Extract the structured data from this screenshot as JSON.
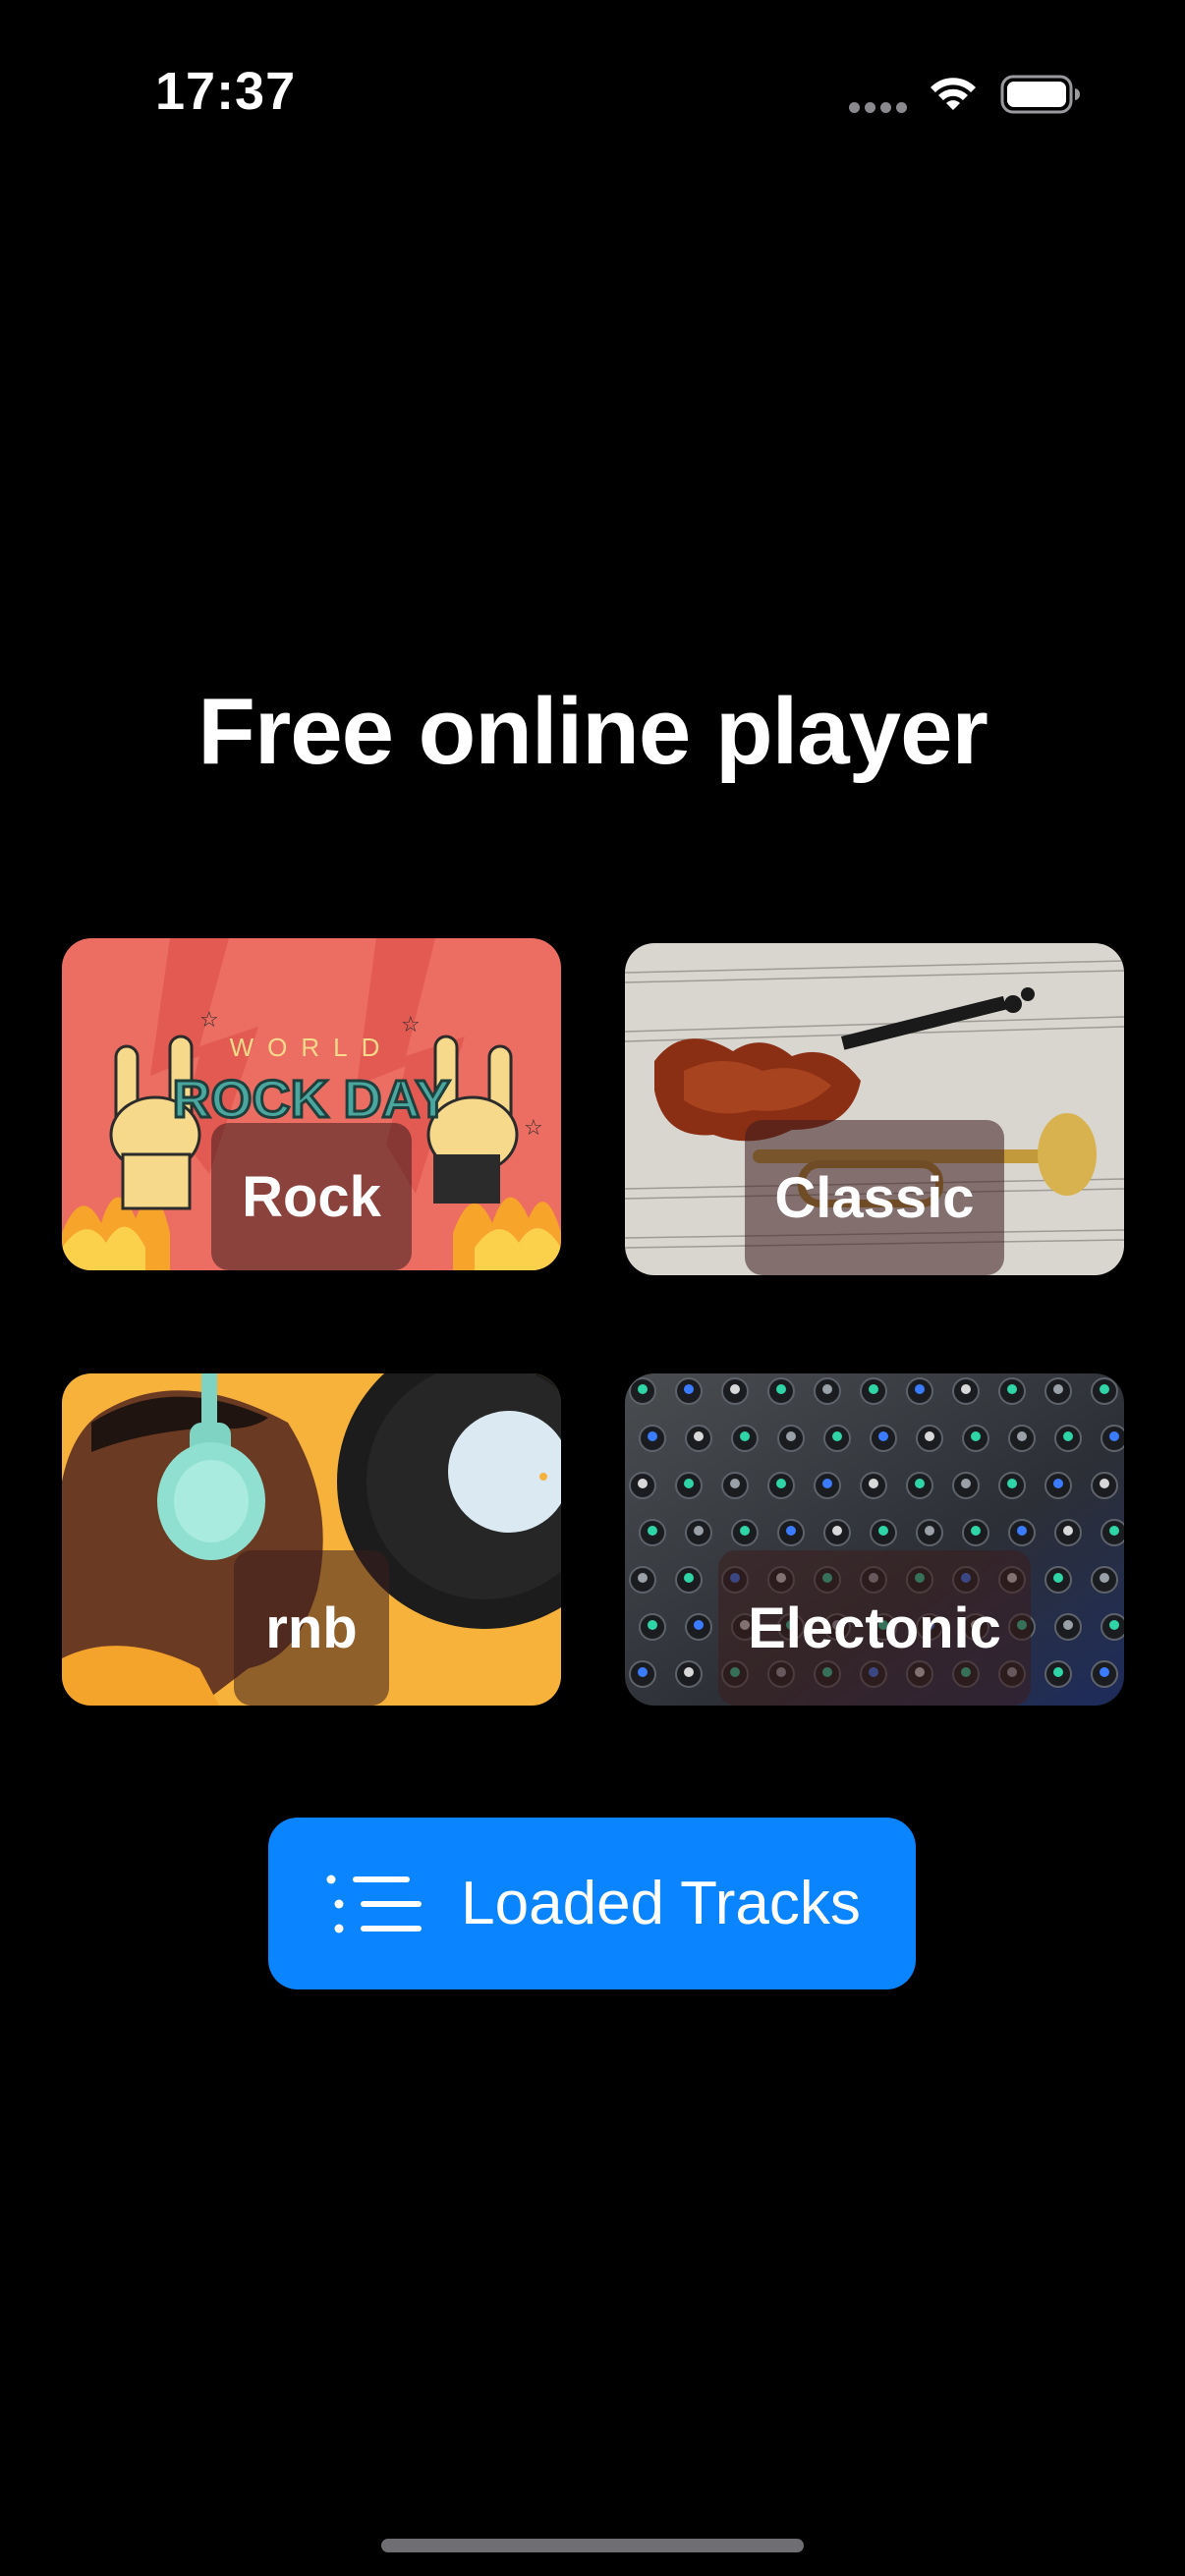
{
  "status_bar": {
    "time": "17:37",
    "icons": [
      "signal-dots-icon",
      "wifi-icon",
      "battery-icon"
    ]
  },
  "title": "Free online player",
  "genres": [
    {
      "id": "rock",
      "label": "Rock",
      "image": "world-rock-day-hands-illustration"
    },
    {
      "id": "classic",
      "label": "Classic",
      "image": "violin-and-trumpet-on-sheet-music"
    },
    {
      "id": "rnb",
      "label": "rnb",
      "image": "person-with-headphones-and-vinyl-record"
    },
    {
      "id": "electonic",
      "label": "Electonic",
      "image": "mixing-console-knobs"
    }
  ],
  "rock_art": {
    "world_text": "WORLD",
    "rock_day_text": "ROCK DAY"
  },
  "loaded_tracks_button": {
    "label": "Loaded Tracks",
    "icon": "list-icon",
    "color": "#0a84ff"
  },
  "colors": {
    "background": "#000000",
    "accent": "#0a84ff"
  }
}
